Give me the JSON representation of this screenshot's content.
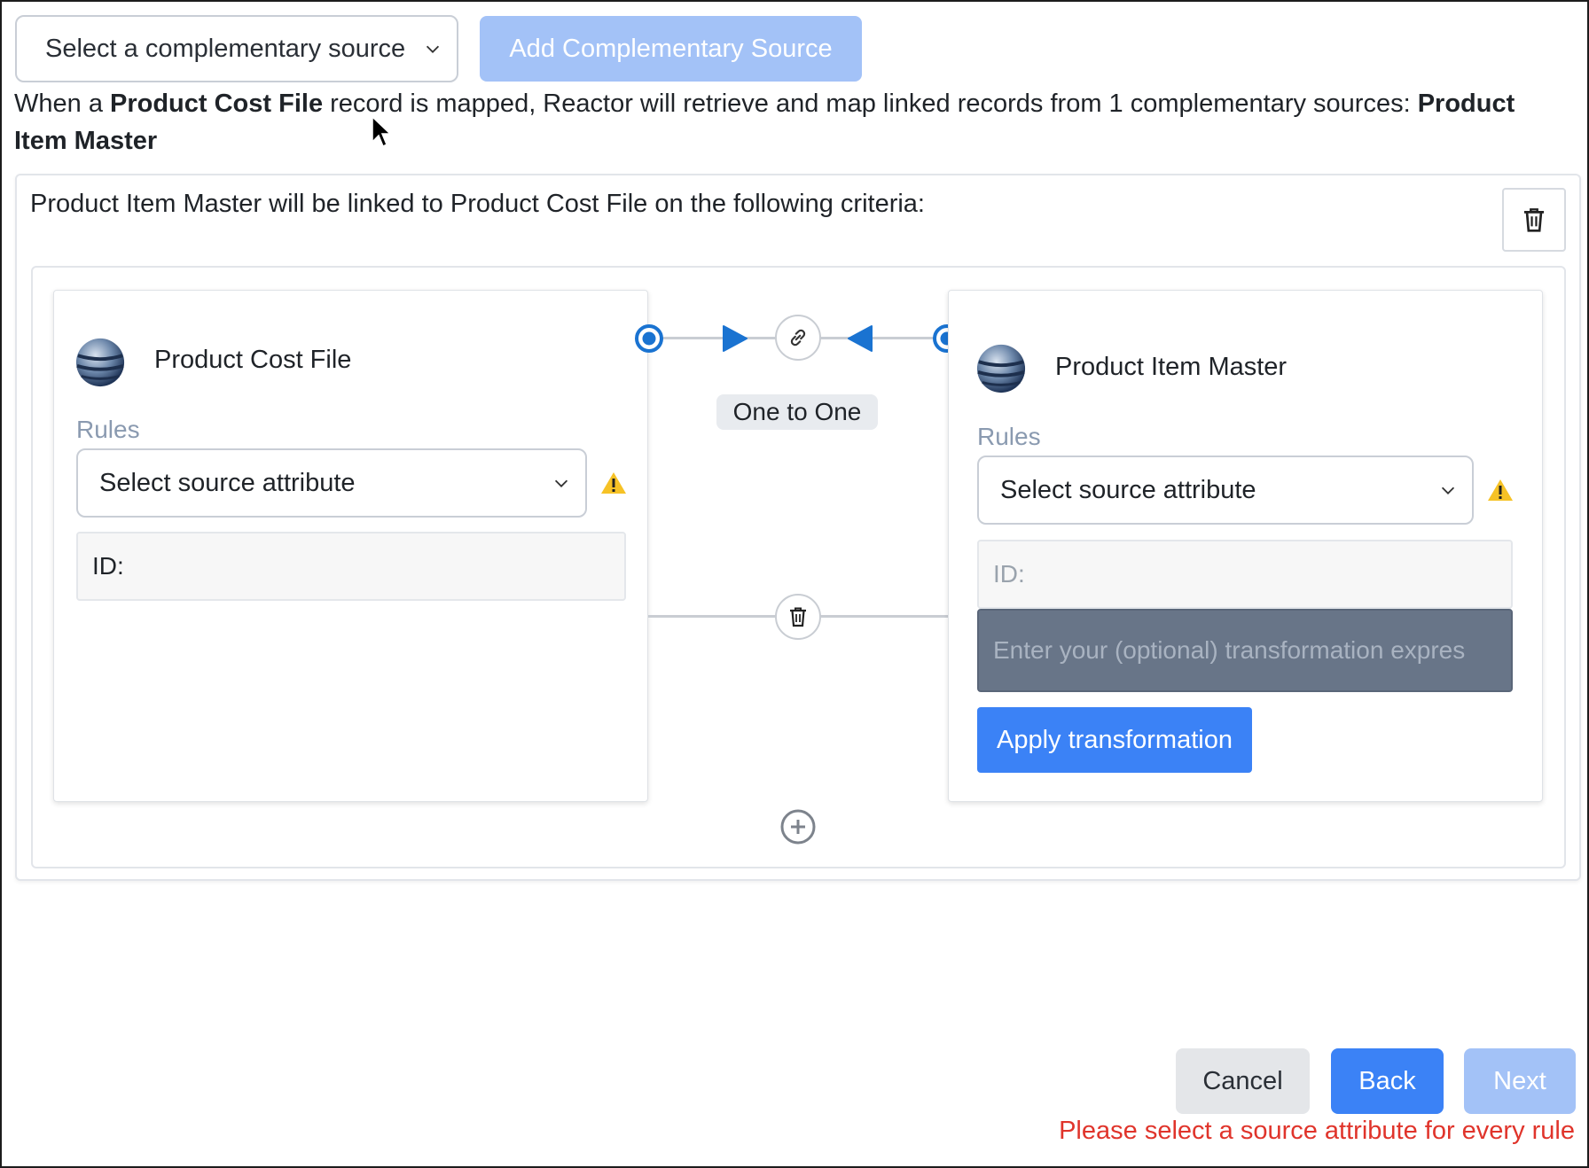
{
  "toolbar": {
    "source_select": {
      "value": "Select a complementary source"
    },
    "add_button_label": "Add Complementary Source"
  },
  "summary": {
    "part1": "When a ",
    "source_name": "Product Cost File",
    "part2": " record is mapped, Reactor will retrieve and map linked records from 1 complementary sources: ",
    "complementary_name": "Product Item Master"
  },
  "link": {
    "criteria_text": "Product Item Master will be linked to Product Cost File on the following criteria:",
    "relationship": "One to One",
    "left": {
      "title": "Product Cost File",
      "rules_label": "Rules",
      "attribute_select": "Select source attribute",
      "id_label": "ID:"
    },
    "right": {
      "title": "Product Item Master",
      "rules_label": "Rules",
      "attribute_select": "Select source attribute",
      "id_placeholder": "ID:",
      "transformation_placeholder": "Enter your (optional) transformation expres",
      "apply_label": "Apply transformation"
    }
  },
  "footer": {
    "cancel_label": "Cancel",
    "back_label": "Back",
    "next_label": "Next",
    "error_message": "Please select a source attribute for every rule"
  },
  "colors": {
    "primary": "#3b82f6",
    "primary_disabled": "#a3c2f7",
    "connector_blue": "#1a73d1",
    "error": "#e0342b",
    "warning": "#f6c226"
  }
}
